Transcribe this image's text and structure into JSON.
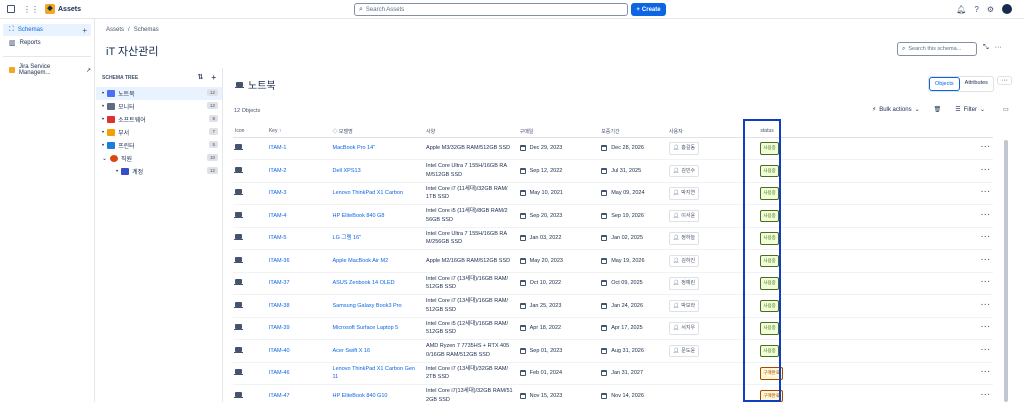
{
  "app": {
    "title": "Assets"
  },
  "search": {
    "placeholder": "Search Assets"
  },
  "create_label": "Create",
  "sidebar": {
    "items": [
      {
        "label": "Schemas"
      },
      {
        "label": "Reports"
      },
      {
        "label": "Jira Service Managem..."
      }
    ]
  },
  "breadcrumb": {
    "assets": "Assets",
    "schemas": "Schemas",
    "sep": "/"
  },
  "page_title": "iT 자산관리",
  "schema_search": {
    "placeholder": "Search this schema..."
  },
  "tree": {
    "header": "SCHEMA TREE",
    "items": [
      {
        "label": "노트북",
        "count": "12",
        "color": "#4c6ef5"
      },
      {
        "label": "모니터",
        "count": "12",
        "color": "#5e6c84"
      },
      {
        "label": "소프트웨어",
        "count": "8",
        "color": "#e03131"
      },
      {
        "label": "부서",
        "count": "7",
        "color": "#f59f00"
      },
      {
        "label": "프린터",
        "count": "5",
        "color": "#1c7ed6"
      },
      {
        "label": "직원",
        "count": "10",
        "color": "#d9480f"
      },
      {
        "label": "계정",
        "count": "12",
        "color": "#364fc7"
      }
    ]
  },
  "objects": {
    "title": "노트북",
    "count_label": "12 Objects",
    "tabs": [
      "Objects",
      "Attributes"
    ],
    "bulk_actions": "Bulk actions",
    "filter": "Filter",
    "columns": [
      "Icon",
      "Key",
      "모델명",
      "사양",
      "구매일",
      "보증기간",
      "사용자",
      "status"
    ],
    "rows": [
      {
        "key": "ITAM-1",
        "model": "MacBook Pro 14\"",
        "spec": "Apple M3/32GB RAM/512GB SSD",
        "purchase": "Dec 29, 2023",
        "warranty": "Dec 28, 2026",
        "user": "홍길동",
        "status": "사용중"
      },
      {
        "key": "ITAM-2",
        "model": "Dell XPS13",
        "spec": "Intel Core Ultra 7 155H/16GB RA M/512GB SSD",
        "purchase": "Sep 12, 2022",
        "warranty": "Jul 31, 2025",
        "user": "김민수",
        "status": "사용중"
      },
      {
        "key": "ITAM-3",
        "model": "Lenovo ThinkPad X1 Carbon",
        "spec": "Intel Core i7 (11세대)/32GB RAM/ 1TB SSD",
        "purchase": "May 10, 2021",
        "warranty": "May 09, 2024",
        "user": "박지연",
        "status": "사용중"
      },
      {
        "key": "ITAM-4",
        "model": "HP EliteBook 840 G8",
        "spec": "Intel Core i5 (11세대)/8GB RAM/2 56GB SSD",
        "purchase": "Sep 20, 2023",
        "warranty": "Sep 19, 2026",
        "user": "이서윤",
        "status": "사용중"
      },
      {
        "key": "ITAM-5",
        "model": "LG 그램 16\"",
        "spec": "Intel Core Ultra 7 155H/16GB RA M/256GB SSD",
        "purchase": "Jan 03, 2022",
        "warranty": "Jan 02, 2025",
        "user": "정하늘",
        "status": "사용중"
      },
      {
        "key": "ITAM-36",
        "model": "Apple MacBook Air M2",
        "spec": "Apple M2/16GB RAM/512GB SSD",
        "purchase": "May 20, 2023",
        "warranty": "May 19, 2026",
        "user": "김하진",
        "status": "사용중"
      },
      {
        "key": "ITAM-37",
        "model": "ASUS Zenbook 14 OLED",
        "spec": "Intel Core i7 (13세대)/16GB RAM/ 512GB SSD",
        "purchase": "Oct 10, 2022",
        "warranty": "Oct 09, 2025",
        "user": "정예린",
        "status": "사용중"
      },
      {
        "key": "ITAM-38",
        "model": "Samsung Galaxy Book3 Pro",
        "spec": "Intel Core i7 (13세대)/16GB RAM/ 512GB SSD",
        "purchase": "Jan 25, 2023",
        "warranty": "Jan 24, 2026",
        "user": "박보라",
        "status": "사용중"
      },
      {
        "key": "ITAM-39",
        "model": "Microsoft Surface Laptop 5",
        "spec": "Intel Core i5 (12세대)/16GB RAM/ 512GB SSD",
        "purchase": "Apr 18, 2022",
        "warranty": "Apr 17, 2025",
        "user": "서지우",
        "status": "사용중"
      },
      {
        "key": "ITAM-40",
        "model": "Acer Swift X 16",
        "spec": "AMD Ryzen 7 7735HS + RTX 405 0/16GB RAM/512GB SSD",
        "purchase": "Sep 01, 2023",
        "warranty": "Aug 31, 2026",
        "user": "문도윤",
        "status": "사용중"
      },
      {
        "key": "ITAM-46",
        "model": "Lenovo ThinkPad X1 Carbon Gen 11",
        "spec": "Intel Core i7 (13세대)/32GB RAM/ 2TB SSD",
        "purchase": "Feb 01, 2024",
        "warranty": "Jan 31, 2027",
        "user": "",
        "status": "구매완료"
      },
      {
        "key": "ITAM-47",
        "model": "HP EliteBook 840 G10",
        "spec": "Intel Core i7(13세대)/32GB RAM/51 2GB SSD",
        "purchase": "Nov 15, 2023",
        "warranty": "Nov 14, 2026",
        "user": "",
        "status": "구매완료"
      }
    ]
  },
  "colors": {
    "accent": "#0c66e4",
    "in_use_bg": "#efffd6",
    "in_use_fg": "#4c6b1f",
    "purchased_bg": "#fff7d6",
    "purchased_fg": "#a54800",
    "highlight": "#0f3fbf"
  }
}
